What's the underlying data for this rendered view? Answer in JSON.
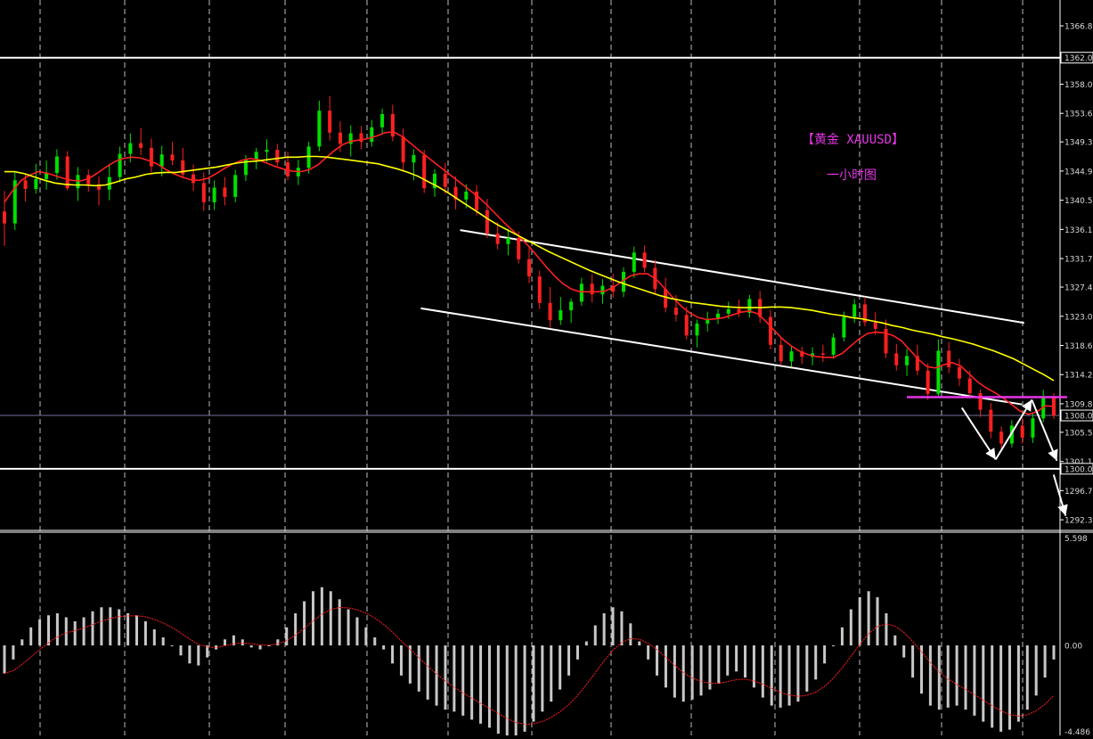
{
  "chart_data": [
    {
      "type": "candlestick",
      "title": "【黄金 XAUUSD】",
      "subtitle": "一小时图",
      "ylim": [
        1290.7,
        1370.7
      ],
      "y_ticks": [
        "1366.80",
        "1362.00",
        "1358.00",
        "1353.60",
        "1349.30",
        "1344.90",
        "1340.50",
        "1336.10",
        "1331.70",
        "1327.40",
        "1323.00",
        "1318.60",
        "1314.20",
        "1309.80",
        "1308.04",
        "1305.50",
        "1301.10",
        "1300.00",
        "1296.70",
        "1292.30"
      ],
      "horizontal_levels": [
        {
          "price": 1362.0,
          "color": "#ffffff"
        },
        {
          "price": 1300.0,
          "color": "#ffffff"
        },
        {
          "price": 1308.04,
          "color": "#6f6f9a"
        }
      ],
      "magenta_level": {
        "price": 1310.8,
        "color": "#e536e5"
      },
      "current_price": "1308.04",
      "series": [
        {
          "color": "#ff2020",
          "values": [
            1340.2,
            1342.0,
            1343.5,
            1344.3,
            1344.8,
            1344.6,
            1344.2,
            1343.8,
            1343.5,
            1343.4,
            1343.8,
            1344.6,
            1345.5,
            1346.3,
            1346.8,
            1347.0,
            1346.9,
            1346.5,
            1346.0,
            1345.2,
            1344.5,
            1344.0,
            1343.6,
            1343.5,
            1343.8,
            1344.5,
            1345.3,
            1346.0,
            1346.5,
            1346.8,
            1346.6,
            1346.1,
            1345.6,
            1345.2,
            1344.9,
            1344.8,
            1345.1,
            1345.8,
            1346.9,
            1348.0,
            1348.9,
            1349.4,
            1349.6,
            1349.8,
            1350.2,
            1350.7,
            1350.8,
            1350.1,
            1349.1,
            1348.0,
            1347.0,
            1346.0,
            1345.0,
            1344.0,
            1343.0,
            1342.0,
            1341.0,
            1339.8,
            1338.5,
            1337.2,
            1336.0,
            1334.8,
            1333.5,
            1332.0,
            1330.5,
            1329.1,
            1327.9,
            1327.1,
            1326.7,
            1326.7,
            1326.7,
            1326.8,
            1327.4,
            1328.3,
            1329.1,
            1329.4,
            1329.4,
            1328.6,
            1327.2,
            1325.8,
            1324.5,
            1323.5,
            1322.8,
            1322.5,
            1322.6,
            1322.8,
            1323.2,
            1323.6,
            1323.8,
            1323.4,
            1322.2,
            1320.8,
            1319.5,
            1318.5,
            1317.7,
            1317.2,
            1316.9,
            1316.8,
            1316.8,
            1317.4,
            1318.5,
            1319.6,
            1320.4,
            1320.6,
            1320.5,
            1320.1,
            1319.3,
            1317.9,
            1316.5,
            1315.4,
            1315.2,
            1315.7,
            1316.0,
            1315.5,
            1314.3,
            1313.1,
            1312.2,
            1311.5,
            1310.7,
            1309.7,
            1308.7,
            1308.2,
            1308.6,
            1309.5,
            1309.4
          ]
        },
        {
          "color": "#ffff00",
          "values": [
            1344.8,
            1344.8,
            1344.5,
            1344.0,
            1343.5,
            1343.1,
            1342.9,
            1342.8,
            1342.8,
            1342.7,
            1342.8,
            1343.2,
            1343.7,
            1344.0,
            1344.4,
            1344.6,
            1344.7,
            1344.7,
            1344.9,
            1345.1,
            1345.3,
            1345.5,
            1345.8,
            1346.1,
            1346.3,
            1346.4,
            1346.6,
            1346.8,
            1347.0,
            1347.0,
            1347.1,
            1347.1,
            1347.0,
            1346.8,
            1346.6,
            1346.4,
            1346.2,
            1346.0,
            1345.6,
            1345.2,
            1344.7,
            1344.1,
            1343.3,
            1342.5,
            1341.6,
            1340.6,
            1339.6,
            1338.6,
            1337.6,
            1336.7,
            1335.9,
            1335.1,
            1334.3,
            1333.5,
            1332.7,
            1332.0,
            1331.3,
            1330.6,
            1329.9,
            1329.3,
            1328.7,
            1328.1,
            1327.6,
            1327.1,
            1326.6,
            1326.1,
            1325.7,
            1325.4,
            1325.1,
            1324.9,
            1324.7,
            1324.5,
            1324.4,
            1324.3,
            1324.3,
            1324.3,
            1324.4,
            1324.4,
            1324.3,
            1324.1,
            1323.9,
            1323.6,
            1323.3,
            1323.1,
            1322.8,
            1322.6,
            1322.3,
            1322.0,
            1321.6,
            1321.3,
            1320.9,
            1320.6,
            1320.3,
            1319.9,
            1319.6,
            1319.2,
            1318.8,
            1318.3,
            1317.8,
            1317.2,
            1316.6,
            1315.8,
            1315.0,
            1314.2,
            1313.3
          ]
        }
      ],
      "candles": [
        {
          "o": 1338.8,
          "h": 1341.9,
          "l": 1333.6,
          "c": 1337.0
        },
        {
          "o": 1337.0,
          "h": 1344.7,
          "l": 1336.0,
          "c": 1343.5
        },
        {
          "o": 1343.5,
          "h": 1344.5,
          "l": 1340.3,
          "c": 1342.2
        },
        {
          "o": 1342.2,
          "h": 1346.0,
          "l": 1341.5,
          "c": 1343.7
        },
        {
          "o": 1343.7,
          "h": 1346.5,
          "l": 1342.1,
          "c": 1344.6
        },
        {
          "o": 1344.6,
          "h": 1348.2,
          "l": 1343.6,
          "c": 1347.1
        },
        {
          "o": 1347.1,
          "h": 1347.9,
          "l": 1342.0,
          "c": 1342.3
        },
        {
          "o": 1342.3,
          "h": 1345.5,
          "l": 1340.4,
          "c": 1344.3
        },
        {
          "o": 1344.3,
          "h": 1345.1,
          "l": 1341.8,
          "c": 1342.9
        },
        {
          "o": 1342.9,
          "h": 1344.1,
          "l": 1339.7,
          "c": 1342.1
        },
        {
          "o": 1342.1,
          "h": 1346.0,
          "l": 1340.5,
          "c": 1344.0
        },
        {
          "o": 1344.0,
          "h": 1348.6,
          "l": 1343.2,
          "c": 1347.5
        },
        {
          "o": 1347.5,
          "h": 1350.6,
          "l": 1346.2,
          "c": 1349.1
        },
        {
          "o": 1349.1,
          "h": 1351.4,
          "l": 1347.3,
          "c": 1348.4
        },
        {
          "o": 1348.4,
          "h": 1349.8,
          "l": 1344.7,
          "c": 1345.6
        },
        {
          "o": 1345.6,
          "h": 1348.7,
          "l": 1344.1,
          "c": 1347.4
        },
        {
          "o": 1347.4,
          "h": 1349.3,
          "l": 1345.8,
          "c": 1346.5
        },
        {
          "o": 1346.5,
          "h": 1348.4,
          "l": 1343.8,
          "c": 1344.4
        },
        {
          "o": 1344.4,
          "h": 1345.9,
          "l": 1341.9,
          "c": 1343.1
        },
        {
          "o": 1343.1,
          "h": 1344.7,
          "l": 1338.9,
          "c": 1340.2
        },
        {
          "o": 1340.2,
          "h": 1343.5,
          "l": 1339.0,
          "c": 1342.4
        },
        {
          "o": 1342.4,
          "h": 1344.0,
          "l": 1339.7,
          "c": 1341.0
        },
        {
          "o": 1341.0,
          "h": 1345.1,
          "l": 1340.2,
          "c": 1344.3
        },
        {
          "o": 1344.3,
          "h": 1347.3,
          "l": 1343.4,
          "c": 1346.6
        },
        {
          "o": 1346.6,
          "h": 1348.4,
          "l": 1345.2,
          "c": 1347.8
        },
        {
          "o": 1347.8,
          "h": 1349.7,
          "l": 1346.3,
          "c": 1348.1
        },
        {
          "o": 1348.1,
          "h": 1349.0,
          "l": 1345.7,
          "c": 1346.2
        },
        {
          "o": 1346.2,
          "h": 1347.8,
          "l": 1343.5,
          "c": 1344.1
        },
        {
          "o": 1344.1,
          "h": 1346.6,
          "l": 1342.8,
          "c": 1345.4
        },
        {
          "o": 1345.4,
          "h": 1349.3,
          "l": 1344.5,
          "c": 1348.6
        },
        {
          "o": 1348.6,
          "h": 1355.5,
          "l": 1347.9,
          "c": 1354.0
        },
        {
          "o": 1354.0,
          "h": 1356.2,
          "l": 1349.5,
          "c": 1350.7
        },
        {
          "o": 1350.7,
          "h": 1352.4,
          "l": 1347.8,
          "c": 1349.0
        },
        {
          "o": 1349.0,
          "h": 1351.8,
          "l": 1347.1,
          "c": 1350.6
        },
        {
          "o": 1350.6,
          "h": 1351.7,
          "l": 1348.2,
          "c": 1349.3
        },
        {
          "o": 1349.3,
          "h": 1352.6,
          "l": 1348.6,
          "c": 1351.5
        },
        {
          "o": 1351.5,
          "h": 1354.3,
          "l": 1350.4,
          "c": 1353.5
        },
        {
          "o": 1353.5,
          "h": 1354.9,
          "l": 1349.4,
          "c": 1350.1
        },
        {
          "o": 1350.1,
          "h": 1351.3,
          "l": 1345.0,
          "c": 1346.2
        },
        {
          "o": 1346.2,
          "h": 1348.2,
          "l": 1343.5,
          "c": 1347.3
        },
        {
          "o": 1347.3,
          "h": 1348.1,
          "l": 1341.6,
          "c": 1342.3
        },
        {
          "o": 1342.3,
          "h": 1345.2,
          "l": 1341.0,
          "c": 1344.5
        },
        {
          "o": 1344.5,
          "h": 1346.1,
          "l": 1341.5,
          "c": 1342.5
        },
        {
          "o": 1342.5,
          "h": 1344.1,
          "l": 1339.1,
          "c": 1340.6
        },
        {
          "o": 1340.6,
          "h": 1342.9,
          "l": 1339.3,
          "c": 1341.8
        },
        {
          "o": 1341.8,
          "h": 1342.8,
          "l": 1338.2,
          "c": 1339.0
        },
        {
          "o": 1339.0,
          "h": 1340.7,
          "l": 1334.8,
          "c": 1335.5
        },
        {
          "o": 1335.5,
          "h": 1337.2,
          "l": 1333.1,
          "c": 1333.9
        },
        {
          "o": 1333.9,
          "h": 1336.2,
          "l": 1332.2,
          "c": 1334.8
        },
        {
          "o": 1334.8,
          "h": 1335.8,
          "l": 1331.0,
          "c": 1331.6
        },
        {
          "o": 1331.6,
          "h": 1333.4,
          "l": 1328.0,
          "c": 1329.0
        },
        {
          "o": 1329.0,
          "h": 1329.9,
          "l": 1324.1,
          "c": 1325.0
        },
        {
          "o": 1325.0,
          "h": 1327.4,
          "l": 1321.3,
          "c": 1322.4
        },
        {
          "o": 1322.4,
          "h": 1325.9,
          "l": 1321.7,
          "c": 1323.9
        },
        {
          "o": 1323.9,
          "h": 1325.7,
          "l": 1322.0,
          "c": 1325.2
        },
        {
          "o": 1325.2,
          "h": 1328.8,
          "l": 1324.6,
          "c": 1327.9
        },
        {
          "o": 1327.9,
          "h": 1329.3,
          "l": 1325.1,
          "c": 1326.3
        },
        {
          "o": 1326.3,
          "h": 1328.6,
          "l": 1324.9,
          "c": 1327.6
        },
        {
          "o": 1327.6,
          "h": 1329.4,
          "l": 1325.8,
          "c": 1326.7
        },
        {
          "o": 1326.7,
          "h": 1330.4,
          "l": 1325.9,
          "c": 1329.7
        },
        {
          "o": 1329.7,
          "h": 1333.5,
          "l": 1328.8,
          "c": 1332.6
        },
        {
          "o": 1332.6,
          "h": 1333.7,
          "l": 1329.6,
          "c": 1330.3
        },
        {
          "o": 1330.3,
          "h": 1331.5,
          "l": 1326.4,
          "c": 1327.1
        },
        {
          "o": 1327.1,
          "h": 1328.8,
          "l": 1323.6,
          "c": 1324.3
        },
        {
          "o": 1324.3,
          "h": 1326.2,
          "l": 1322.2,
          "c": 1323.2
        },
        {
          "o": 1323.2,
          "h": 1324.4,
          "l": 1319.5,
          "c": 1320.1
        },
        {
          "o": 1320.1,
          "h": 1322.5,
          "l": 1318.3,
          "c": 1321.9
        },
        {
          "o": 1321.9,
          "h": 1323.7,
          "l": 1320.7,
          "c": 1322.6
        },
        {
          "o": 1322.6,
          "h": 1324.1,
          "l": 1321.8,
          "c": 1323.4
        },
        {
          "o": 1323.4,
          "h": 1325.2,
          "l": 1322.6,
          "c": 1324.1
        },
        {
          "o": 1324.1,
          "h": 1325.5,
          "l": 1322.9,
          "c": 1323.5
        },
        {
          "o": 1323.5,
          "h": 1326.2,
          "l": 1322.8,
          "c": 1325.6
        },
        {
          "o": 1325.6,
          "h": 1326.8,
          "l": 1322.0,
          "c": 1322.9
        },
        {
          "o": 1322.9,
          "h": 1324.0,
          "l": 1318.0,
          "c": 1318.7
        },
        {
          "o": 1318.7,
          "h": 1319.9,
          "l": 1315.6,
          "c": 1316.2
        },
        {
          "o": 1316.2,
          "h": 1318.5,
          "l": 1315.4,
          "c": 1317.7
        },
        {
          "o": 1317.7,
          "h": 1318.4,
          "l": 1315.8,
          "c": 1316.9
        },
        {
          "o": 1316.9,
          "h": 1318.3,
          "l": 1315.6,
          "c": 1317.4
        },
        {
          "o": 1317.4,
          "h": 1318.7,
          "l": 1316.1,
          "c": 1317.2
        },
        {
          "o": 1317.2,
          "h": 1320.4,
          "l": 1316.6,
          "c": 1319.8
        },
        {
          "o": 1319.8,
          "h": 1323.7,
          "l": 1319.2,
          "c": 1322.9
        },
        {
          "o": 1322.9,
          "h": 1325.6,
          "l": 1322.0,
          "c": 1324.8
        },
        {
          "o": 1324.8,
          "h": 1325.9,
          "l": 1321.5,
          "c": 1322.1
        },
        {
          "o": 1322.1,
          "h": 1323.6,
          "l": 1320.2,
          "c": 1321.1
        },
        {
          "o": 1321.1,
          "h": 1322.5,
          "l": 1316.7,
          "c": 1317.4
        },
        {
          "o": 1317.4,
          "h": 1318.8,
          "l": 1314.8,
          "c": 1315.6
        },
        {
          "o": 1315.6,
          "h": 1318.1,
          "l": 1314.0,
          "c": 1317.0
        },
        {
          "o": 1317.0,
          "h": 1318.7,
          "l": 1314.1,
          "c": 1314.8
        },
        {
          "o": 1314.8,
          "h": 1315.9,
          "l": 1310.4,
          "c": 1311.3
        },
        {
          "o": 1311.3,
          "h": 1319.5,
          "l": 1310.8,
          "c": 1317.8
        },
        {
          "o": 1317.8,
          "h": 1319.1,
          "l": 1314.4,
          "c": 1315.3
        },
        {
          "o": 1315.3,
          "h": 1316.6,
          "l": 1312.5,
          "c": 1313.6
        },
        {
          "o": 1313.6,
          "h": 1314.8,
          "l": 1310.6,
          "c": 1311.4
        },
        {
          "o": 1311.4,
          "h": 1312.0,
          "l": 1307.8,
          "c": 1308.9
        },
        {
          "o": 1308.9,
          "h": 1309.9,
          "l": 1304.6,
          "c": 1305.6
        },
        {
          "o": 1305.6,
          "h": 1306.4,
          "l": 1302.6,
          "c": 1303.8
        },
        {
          "o": 1303.8,
          "h": 1307.3,
          "l": 1303.2,
          "c": 1306.5
        },
        {
          "o": 1306.5,
          "h": 1307.6,
          "l": 1303.8,
          "c": 1304.7
        },
        {
          "o": 1304.7,
          "h": 1308.4,
          "l": 1303.9,
          "c": 1307.6
        },
        {
          "o": 1307.6,
          "h": 1311.9,
          "l": 1307.0,
          "c": 1310.9
        },
        {
          "o": 1310.9,
          "h": 1311.4,
          "l": 1307.5,
          "c": 1308.0
        }
      ],
      "trendlines": [
        {
          "x1": 0.421,
          "y1": 1336.0,
          "x2": 0.937,
          "y2": 1322.0,
          "color": "#ffffff"
        },
        {
          "x1": 0.385,
          "y1": 1324.2,
          "x2": 0.935,
          "y2": 1309.7,
          "color": "#ffffff"
        }
      ],
      "arrows": [
        {
          "from": [
            0.88,
            1309.2
          ],
          "to": [
            0.911,
            1301.4
          ]
        },
        {
          "from": [
            0.911,
            1301.4
          ],
          "to": [
            0.944,
            1310.4
          ]
        },
        {
          "from": [
            0.944,
            1310.4
          ],
          "to": [
            0.967,
            1301.2
          ]
        },
        {
          "from": [
            0.964,
            1299.1
          ],
          "to": [
            0.975,
            1292.9
          ]
        }
      ]
    },
    {
      "type": "histogram",
      "ylim": [
        -4.486,
        5.598
      ],
      "y_ticks": [
        "5.598",
        "0.00",
        "-4.486"
      ],
      "values": [
        -1.4,
        -0.7,
        0.3,
        0.9,
        1.3,
        1.5,
        1.6,
        1.4,
        1.2,
        1.4,
        1.7,
        1.9,
        1.9,
        1.8,
        1.6,
        1.5,
        1.2,
        0.8,
        0.4,
        0.0,
        -0.5,
        -0.9,
        -1.0,
        -0.6,
        -0.2,
        0.3,
        0.5,
        0.3,
        -0.1,
        -0.2,
        0.0,
        0.3,
        0.9,
        1.6,
        2.2,
        2.7,
        2.9,
        2.7,
        2.3,
        1.8,
        1.4,
        0.9,
        0.4,
        -0.2,
        -0.9,
        -1.5,
        -1.9,
        -2.3,
        -2.7,
        -3.0,
        -3.2,
        -3.3,
        -3.5,
        -3.7,
        -3.9,
        -4.1,
        -4.4,
        -4.7,
        -4.6,
        -4.3,
        -3.8,
        -3.3,
        -2.8,
        -2.2,
        -1.5,
        -0.7,
        0.2,
        1.0,
        1.6,
        1.9,
        1.7,
        1.1,
        0.2,
        -0.7,
        -1.5,
        -2.1,
        -2.6,
        -2.8,
        -2.7,
        -2.5,
        -2.2,
        -1.9,
        -1.5,
        -1.3,
        -1.6,
        -2.1,
        -2.6,
        -3.0,
        -3.1,
        -3.0,
        -2.8,
        -2.3,
        -1.7,
        -0.9,
        0.0,
        0.9,
        1.8,
        2.4,
        2.7,
        2.4,
        1.6,
        0.5,
        -0.6,
        -1.6,
        -2.4,
        -3.0,
        -3.2,
        -3.1,
        -3.0,
        -3.2,
        -3.5,
        -3.8,
        -4.1,
        -4.3,
        -4.2,
        -3.8,
        -3.2,
        -2.5,
        -1.6,
        -0.7
      ],
      "signal_color": "#ff2020",
      "bar_color": "#c8c8c8"
    }
  ]
}
